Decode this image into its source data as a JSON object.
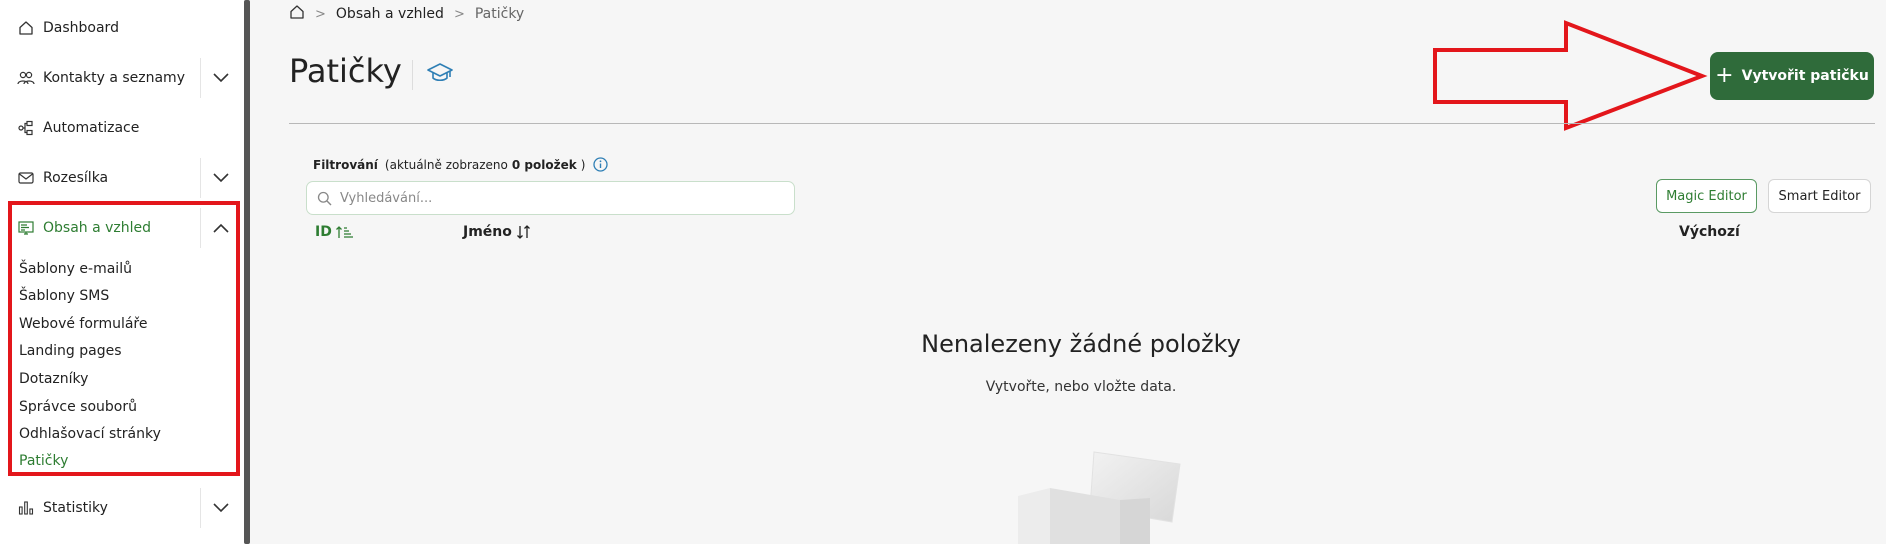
{
  "sidebar": {
    "items": [
      {
        "label": "Dashboard",
        "icon": "home-icon"
      },
      {
        "label": "Kontakty a seznamy",
        "icon": "contacts-icon",
        "expandable": true
      },
      {
        "label": "Automatizace",
        "icon": "automation-icon"
      },
      {
        "label": "Rozesílka",
        "icon": "mail-icon",
        "expandable": true
      },
      {
        "label": "Obsah a vzhled",
        "icon": "content-icon",
        "expandable": true,
        "expanded": true,
        "active": true
      },
      {
        "label": "Statistiky",
        "icon": "stats-icon",
        "expandable": true
      }
    ],
    "subitems": [
      "Šablony e-mailů",
      "Šablony SMS",
      "Webové formuláře",
      "Landing pages",
      "Dotazníky",
      "Správce souborů",
      "Odhlašovací stránky",
      "Patičky"
    ],
    "active_subitem": "Patičky"
  },
  "breadcrumb": {
    "home_icon": "home-icon",
    "items": [
      "Obsah a vzhled",
      "Patičky"
    ]
  },
  "page": {
    "title": "Patičky",
    "help_icon": "graduation-cap-icon"
  },
  "toolbar": {
    "create_label": "Vytvořit patičku",
    "magic_editor_label": "Magic Editor",
    "smart_editor_label": "Smart Editor"
  },
  "filter": {
    "label": "Filtrování",
    "count_prefix": "(aktuálně zobrazeno ",
    "count_value": "0 položek",
    "count_suffix": ")",
    "info_icon": "info-icon",
    "search_placeholder": "Vyhledávání..."
  },
  "table": {
    "columns": [
      "ID",
      "Jméno",
      "Výchozí"
    ]
  },
  "empty_state": {
    "title": "Nenalezeny žádné položky",
    "subtitle": "Vytvořte, nebo vložte data.",
    "illustration": "open-box-illustration"
  },
  "colors": {
    "accent": "#2e7d32",
    "primary_button": "#2f6b3a",
    "annotation": "#e3161b"
  }
}
